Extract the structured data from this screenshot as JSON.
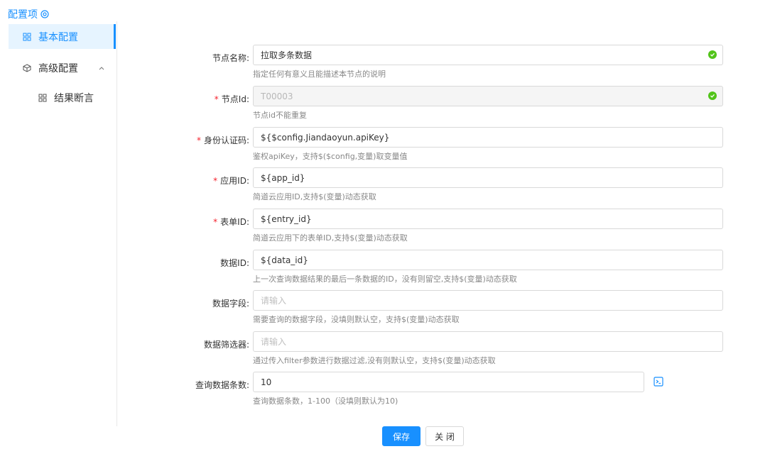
{
  "sidebar": {
    "header_label": "配置项",
    "items": [
      {
        "label": "基本配置",
        "icon": "grid-icon",
        "active": true
      },
      {
        "label": "高级配置",
        "icon": "cube-icon",
        "expanded": true
      },
      {
        "label": "结果断言",
        "icon": "grid-icon"
      }
    ]
  },
  "form": {
    "fields": [
      {
        "label": "节点名称:",
        "required": false,
        "value": "拉取多条数据",
        "placeholder": "",
        "help": "指定任何有意义且能描述本节点的说明",
        "valid": true
      },
      {
        "label": "节点Id:",
        "required": true,
        "value": "T00003",
        "placeholder": "",
        "help": "节点id不能重复",
        "disabled": true,
        "valid": true
      },
      {
        "label": "身份认证码:",
        "required": true,
        "value": "${$config.Jiandaoyun.apiKey}",
        "placeholder": "",
        "help": "鉴权apiKey，支持$($config,变量)取变量值"
      },
      {
        "label": "应用ID:",
        "required": true,
        "value": "${app_id}",
        "placeholder": "",
        "help": "简道云应用ID,支持$(变量)动态获取"
      },
      {
        "label": "表单ID:",
        "required": true,
        "value": "${entry_id}",
        "placeholder": "",
        "help": "简道云应用下的表单ID,支持$(变量)动态获取"
      },
      {
        "label": "数据ID:",
        "required": false,
        "value": "${data_id}",
        "placeholder": "",
        "help": "上一次查询数据结果的最后一条数据的ID，没有则留空,支持$(变量)动态获取"
      },
      {
        "label": "数据字段:",
        "required": false,
        "value": "",
        "placeholder": "请输入",
        "help": "需要查询的数据字段，没填则默认空，支持$(变量)动态获取"
      },
      {
        "label": "数据筛选器:",
        "required": false,
        "value": "",
        "placeholder": "请输入",
        "help": "通过传入filter参数进行数据过滤,没有则默认空，支持$(变量)动态获取"
      },
      {
        "label": "查询数据条数:",
        "required": true,
        "value": "10",
        "placeholder": "",
        "help": "查询数据条数，1-100（没填则默认为10)"
      }
    ]
  },
  "buttons": {
    "save": "保存",
    "close": "关 闭"
  },
  "colors": {
    "accent": "#1890ff",
    "required": "#f5222d",
    "valid": "#52c41a"
  }
}
